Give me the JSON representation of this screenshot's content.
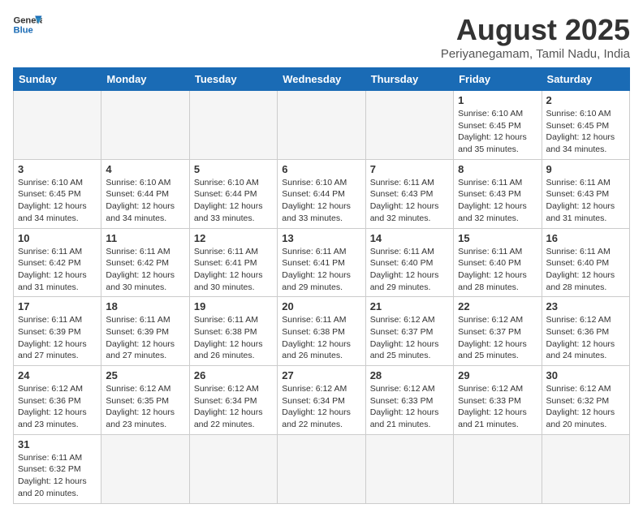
{
  "header": {
    "logo_general": "General",
    "logo_blue": "Blue",
    "title": "August 2025",
    "subtitle": "Periyanegamam, Tamil Nadu, India"
  },
  "weekdays": [
    "Sunday",
    "Monday",
    "Tuesday",
    "Wednesday",
    "Thursday",
    "Friday",
    "Saturday"
  ],
  "weeks": [
    [
      {
        "day": "",
        "info": ""
      },
      {
        "day": "",
        "info": ""
      },
      {
        "day": "",
        "info": ""
      },
      {
        "day": "",
        "info": ""
      },
      {
        "day": "",
        "info": ""
      },
      {
        "day": "1",
        "info": "Sunrise: 6:10 AM\nSunset: 6:45 PM\nDaylight: 12 hours and 35 minutes."
      },
      {
        "day": "2",
        "info": "Sunrise: 6:10 AM\nSunset: 6:45 PM\nDaylight: 12 hours and 34 minutes."
      }
    ],
    [
      {
        "day": "3",
        "info": "Sunrise: 6:10 AM\nSunset: 6:45 PM\nDaylight: 12 hours and 34 minutes."
      },
      {
        "day": "4",
        "info": "Sunrise: 6:10 AM\nSunset: 6:44 PM\nDaylight: 12 hours and 34 minutes."
      },
      {
        "day": "5",
        "info": "Sunrise: 6:10 AM\nSunset: 6:44 PM\nDaylight: 12 hours and 33 minutes."
      },
      {
        "day": "6",
        "info": "Sunrise: 6:10 AM\nSunset: 6:44 PM\nDaylight: 12 hours and 33 minutes."
      },
      {
        "day": "7",
        "info": "Sunrise: 6:11 AM\nSunset: 6:43 PM\nDaylight: 12 hours and 32 minutes."
      },
      {
        "day": "8",
        "info": "Sunrise: 6:11 AM\nSunset: 6:43 PM\nDaylight: 12 hours and 32 minutes."
      },
      {
        "day": "9",
        "info": "Sunrise: 6:11 AM\nSunset: 6:43 PM\nDaylight: 12 hours and 31 minutes."
      }
    ],
    [
      {
        "day": "10",
        "info": "Sunrise: 6:11 AM\nSunset: 6:42 PM\nDaylight: 12 hours and 31 minutes."
      },
      {
        "day": "11",
        "info": "Sunrise: 6:11 AM\nSunset: 6:42 PM\nDaylight: 12 hours and 30 minutes."
      },
      {
        "day": "12",
        "info": "Sunrise: 6:11 AM\nSunset: 6:41 PM\nDaylight: 12 hours and 30 minutes."
      },
      {
        "day": "13",
        "info": "Sunrise: 6:11 AM\nSunset: 6:41 PM\nDaylight: 12 hours and 29 minutes."
      },
      {
        "day": "14",
        "info": "Sunrise: 6:11 AM\nSunset: 6:40 PM\nDaylight: 12 hours and 29 minutes."
      },
      {
        "day": "15",
        "info": "Sunrise: 6:11 AM\nSunset: 6:40 PM\nDaylight: 12 hours and 28 minutes."
      },
      {
        "day": "16",
        "info": "Sunrise: 6:11 AM\nSunset: 6:40 PM\nDaylight: 12 hours and 28 minutes."
      }
    ],
    [
      {
        "day": "17",
        "info": "Sunrise: 6:11 AM\nSunset: 6:39 PM\nDaylight: 12 hours and 27 minutes."
      },
      {
        "day": "18",
        "info": "Sunrise: 6:11 AM\nSunset: 6:39 PM\nDaylight: 12 hours and 27 minutes."
      },
      {
        "day": "19",
        "info": "Sunrise: 6:11 AM\nSunset: 6:38 PM\nDaylight: 12 hours and 26 minutes."
      },
      {
        "day": "20",
        "info": "Sunrise: 6:11 AM\nSunset: 6:38 PM\nDaylight: 12 hours and 26 minutes."
      },
      {
        "day": "21",
        "info": "Sunrise: 6:12 AM\nSunset: 6:37 PM\nDaylight: 12 hours and 25 minutes."
      },
      {
        "day": "22",
        "info": "Sunrise: 6:12 AM\nSunset: 6:37 PM\nDaylight: 12 hours and 25 minutes."
      },
      {
        "day": "23",
        "info": "Sunrise: 6:12 AM\nSunset: 6:36 PM\nDaylight: 12 hours and 24 minutes."
      }
    ],
    [
      {
        "day": "24",
        "info": "Sunrise: 6:12 AM\nSunset: 6:36 PM\nDaylight: 12 hours and 23 minutes."
      },
      {
        "day": "25",
        "info": "Sunrise: 6:12 AM\nSunset: 6:35 PM\nDaylight: 12 hours and 23 minutes."
      },
      {
        "day": "26",
        "info": "Sunrise: 6:12 AM\nSunset: 6:34 PM\nDaylight: 12 hours and 22 minutes."
      },
      {
        "day": "27",
        "info": "Sunrise: 6:12 AM\nSunset: 6:34 PM\nDaylight: 12 hours and 22 minutes."
      },
      {
        "day": "28",
        "info": "Sunrise: 6:12 AM\nSunset: 6:33 PM\nDaylight: 12 hours and 21 minutes."
      },
      {
        "day": "29",
        "info": "Sunrise: 6:12 AM\nSunset: 6:33 PM\nDaylight: 12 hours and 21 minutes."
      },
      {
        "day": "30",
        "info": "Sunrise: 6:12 AM\nSunset: 6:32 PM\nDaylight: 12 hours and 20 minutes."
      }
    ],
    [
      {
        "day": "31",
        "info": "Sunrise: 6:11 AM\nSunset: 6:32 PM\nDaylight: 12 hours and 20 minutes."
      },
      {
        "day": "",
        "info": ""
      },
      {
        "day": "",
        "info": ""
      },
      {
        "day": "",
        "info": ""
      },
      {
        "day": "",
        "info": ""
      },
      {
        "day": "",
        "info": ""
      },
      {
        "day": "",
        "info": ""
      }
    ]
  ]
}
